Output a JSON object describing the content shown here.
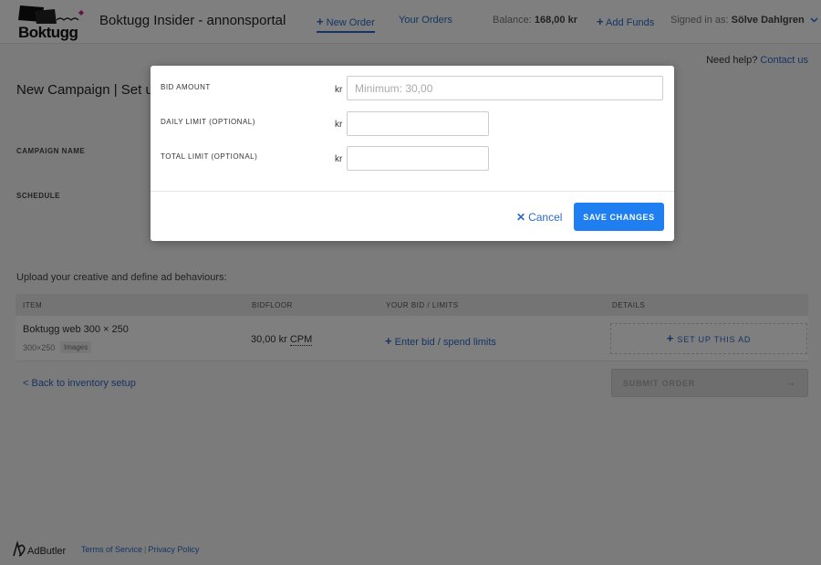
{
  "header": {
    "logo_text": "Boktugg",
    "title": "Boktugg Insider - annonsportal",
    "nav_new_order": "New Order",
    "nav_your_orders": "Your Orders",
    "balance_label": "Balance:",
    "balance_value": "168,00 kr",
    "add_funds": "Add Funds",
    "signed_in_label": "Signed in as:",
    "signed_in_user": "Sölve Dahlgren"
  },
  "help": {
    "text": "Need help?",
    "link": "Contact us"
  },
  "page": {
    "title": "New Campaign | Set up",
    "campaign_name_label": "CAMPAIGN NAME",
    "schedule_label": "SCHEDULE",
    "upload_text": "Upload your creative and define ad behaviours:"
  },
  "table": {
    "headers": [
      "ITEM",
      "BIDFLOOR",
      "YOUR BID / LIMITS",
      "DETAILS"
    ],
    "row": {
      "name": "Boktugg web 300 × 250",
      "size": "300×250",
      "tag": "Images",
      "bidfloor": "30,00 kr",
      "bidfloor_unit": "CPM",
      "enter_bid": "Enter bid / spend limits",
      "setup": "SET UP THIS AD"
    }
  },
  "actions": {
    "back": "< Back to inventory setup",
    "submit": "SUBMIT ORDER"
  },
  "footer": {
    "logo_text": "AdButler",
    "terms": "Terms of Service",
    "privacy": "Privacy Policy"
  },
  "modal": {
    "bid_amount_label": "BID AMOUNT",
    "bid_amount_placeholder": "Minimum: 30,00",
    "daily_limit_label": "DAILY LIMIT (OPTIONAL)",
    "total_limit_label": "TOTAL LIMIT (OPTIONAL)",
    "currency": "kr",
    "cancel": "Cancel",
    "save": "SAVE CHANGES"
  },
  "colors": {
    "accent": "#2b68c9",
    "save_button": "#1f7ff0"
  },
  "icons": {
    "plus": "plus-icon",
    "chevron": "chevron-down-icon",
    "close": "close-icon",
    "arrow": "arrow-right-icon"
  }
}
